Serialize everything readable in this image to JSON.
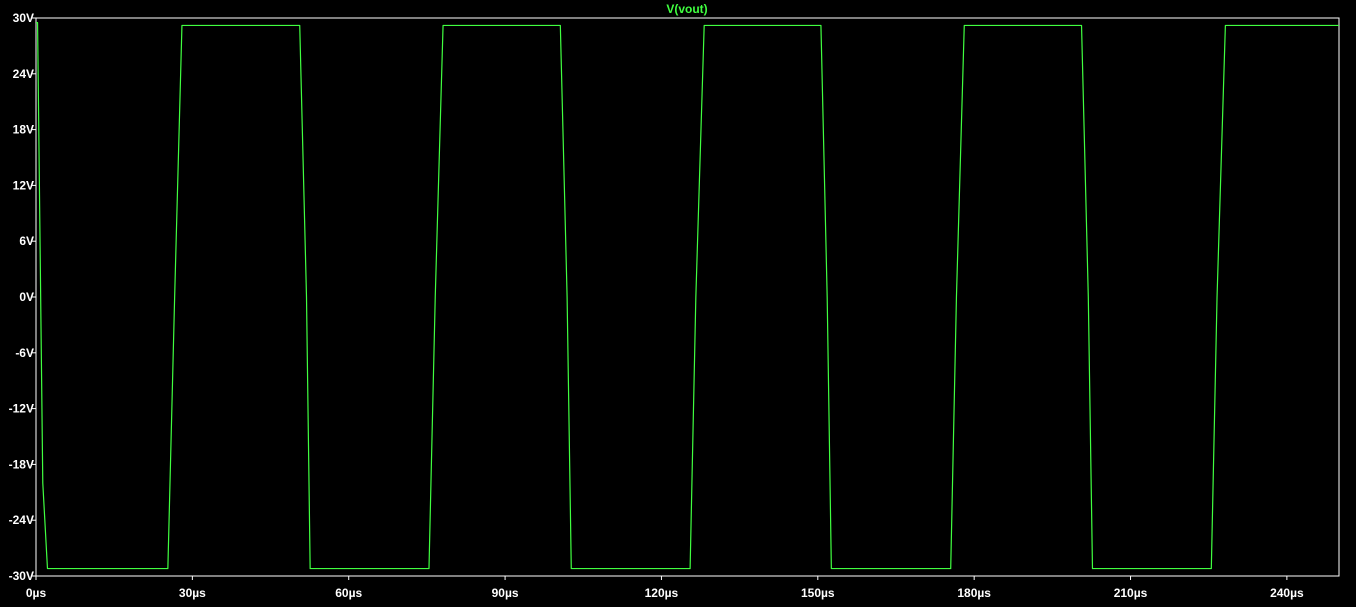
{
  "chart_data": {
    "type": "line",
    "title": "V(vout)",
    "xlabel": "",
    "ylabel": "",
    "xlim": [
      0,
      250
    ],
    "ylim": [
      -30,
      30
    ],
    "grid": false,
    "x_ticks": [
      0,
      30,
      60,
      90,
      120,
      150,
      180,
      210,
      240
    ],
    "x_tick_labels": [
      "0µs",
      "30µs",
      "60µs",
      "90µs",
      "120µs",
      "150µs",
      "180µs",
      "210µs",
      "240µs"
    ],
    "y_ticks": [
      30,
      24,
      18,
      12,
      6,
      0,
      -6,
      -12,
      -18,
      -24,
      -30
    ],
    "y_tick_labels": [
      "30V",
      "24V",
      "18V",
      "12V",
      "6V",
      "0V",
      "-6V",
      "-12V",
      "-18V",
      "-24V",
      "-30V"
    ],
    "series": [
      {
        "name": "V(vout)",
        "color": "#40ff40",
        "x": [
          0,
          0.3,
          1.3,
          2.2,
          25.3,
          26.6,
          28.0,
          50.6,
          51.9,
          52.6,
          75.4,
          76.6,
          78.1,
          100.6,
          101.9,
          102.7,
          125.5,
          126.6,
          128.2,
          150.6,
          151.8,
          152.6,
          175.5,
          176.6,
          178.1,
          200.6,
          201.9,
          202.7,
          225.5,
          226.6,
          228.2,
          250
        ],
        "y": [
          29.5,
          29.5,
          -20,
          -29.2,
          -29.2,
          0,
          29.2,
          29.2,
          0,
          -29.2,
          -29.2,
          0,
          29.2,
          29.2,
          0,
          -29.2,
          -29.2,
          0,
          29.2,
          29.2,
          0,
          -29.2,
          -29.2,
          0,
          29.2,
          29.2,
          0,
          -29.2,
          -29.2,
          0,
          29.2,
          29.2
        ]
      }
    ]
  },
  "colors": {
    "background": "#000000",
    "axis": "#ffffff",
    "text": "#ffffff",
    "trace": "#40ff40"
  }
}
